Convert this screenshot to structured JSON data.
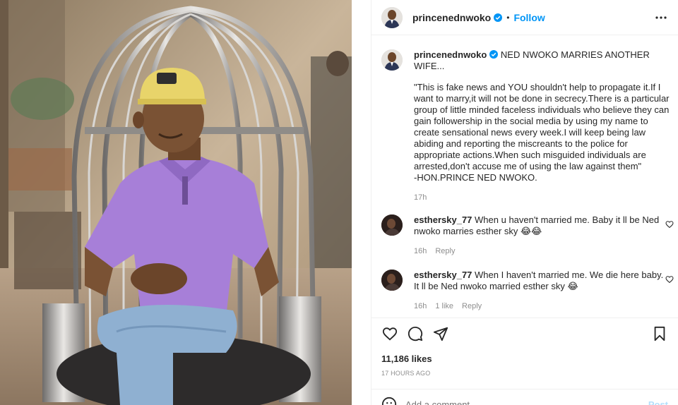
{
  "post": {
    "username": "princenednwoko",
    "follow_label": "Follow",
    "dot": "•"
  },
  "caption": {
    "username": "princenednwoko",
    "headline": "NED NWOKO MARRIES ANOTHER WIFE...",
    "body": "\"This is fake news and YOU shouldn't help to propagate it.If I want to marry,it will not be done in secrecy.There is a particular group of little minded faceless individuals who believe they can gain followership in the social media by using my name to create sensational news every week.I will keep being law abiding and reporting the miscreants to the police for appropriate actions.When such misguided individuals are arrested,don't accuse me of using the law against them\"\n-HON.PRINCE NED NWOKO.",
    "time": "17h"
  },
  "comments": [
    {
      "username": "esthersky_77",
      "text": "When u haven't married me. Baby it ll be Ned nwoko marries esther sky 😂😂",
      "time": "16h",
      "likes": "",
      "reply_label": "Reply"
    },
    {
      "username": "esthersky_77",
      "text": "When I haven't married me. We die here baby. It ll be Ned nwoko married esther sky 😂",
      "time": "16h",
      "likes": "1 like",
      "reply_label": "Reply"
    }
  ],
  "stats": {
    "likes": "11,186 likes",
    "posted_ago": "17 HOURS AGO"
  },
  "composer": {
    "placeholder": "Add a comment...",
    "post_label": "Post"
  },
  "icons": {
    "verified": "verified-badge-icon",
    "more": "more-options-icon",
    "like": "heart-icon",
    "comment": "comment-icon",
    "share": "share-icon",
    "save": "bookmark-icon",
    "emoji": "emoji-icon"
  },
  "colors": {
    "accent": "#0095f6",
    "shirt": "#a77fd8",
    "cap": "#e8d46a"
  }
}
